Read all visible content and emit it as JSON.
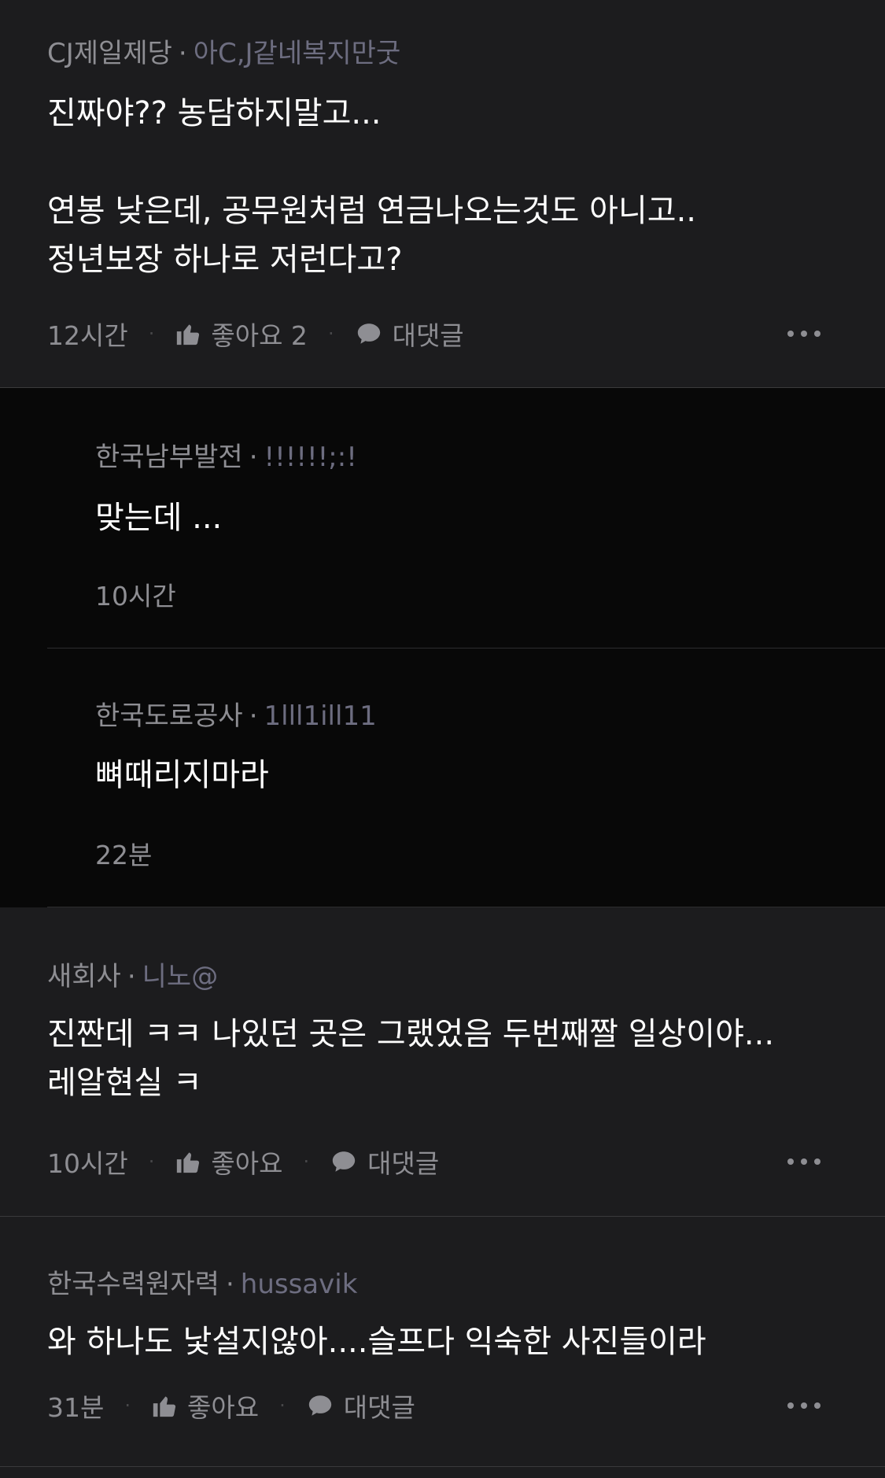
{
  "comments": [
    {
      "company": "CJ제일제당",
      "nickname": "아C,J같네복지만굿",
      "text": "진짜야?? 농담하지말고...\n\n연봉 낮은데, 공무원처럼 연금나오는것도 아니고..\n정년보장 하나로 저런다고?",
      "time": "12시간",
      "like_label": "좋아요 2",
      "reply_label": "대댓글"
    },
    {
      "company": "새회사",
      "nickname": "니노@",
      "text": "진짠데 ㅋㅋ 나있던 곳은 그랬었음 두번째짤 일상이야...\n레알현실 ㅋ",
      "time": "10시간",
      "like_label": "좋아요",
      "reply_label": "대댓글"
    },
    {
      "company": "한국수력원자력",
      "nickname": "hussavik",
      "text": "와 하나도 낯설지않아....슬프다 익숙한 사진들이라",
      "time": "31분",
      "like_label": "좋아요",
      "reply_label": "대댓글"
    }
  ],
  "replies": [
    {
      "company": "한국남부발전",
      "nickname": "!!!!!!;:!",
      "text": "맞는데 ...",
      "time": "10시간"
    },
    {
      "company": "한국도로공사",
      "nickname": "1lll1ill11",
      "text": "뼈때리지마라",
      "time": "22분"
    }
  ],
  "separator": "·",
  "icons": {
    "like": "thumbs-up-icon",
    "reply": "speech-bubble-icon",
    "more": "more-horizontal-icon"
  },
  "colors": {
    "background": "#1c1c1e",
    "reply_background": "#080808",
    "meta_text": "#8e8e93",
    "nickname_text": "#6d6d80",
    "body_text": "#ffffff"
  }
}
